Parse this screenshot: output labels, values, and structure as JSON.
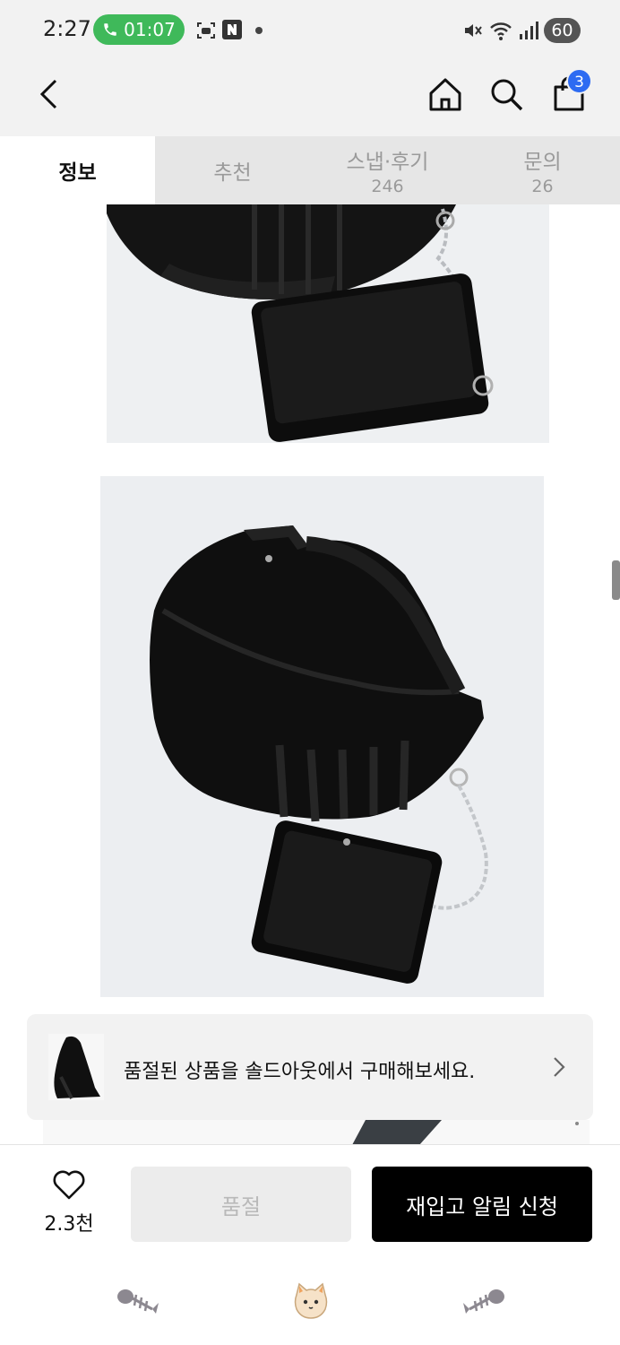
{
  "status_bar": {
    "time": "2:27",
    "call_timer": "01:07",
    "battery": "60",
    "icons": [
      "phone-icon",
      "screen-record-icon",
      "naver-icon",
      "dot-icon",
      "mute-icon",
      "wifi-icon",
      "signal-icon"
    ]
  },
  "nav": {
    "back_icon": "chevron-left-icon",
    "home_icon": "home-icon",
    "search_icon": "search-icon",
    "cart_icon": "shopping-bag-icon",
    "cart_badge": "3",
    "badge_color": "#2d6bf2"
  },
  "tabs": [
    {
      "label": "정보",
      "count": ""
    },
    {
      "label": "추천",
      "count": ""
    },
    {
      "label": "스냅·후기",
      "count": "246"
    },
    {
      "label": "문의",
      "count": "26"
    }
  ],
  "banner": {
    "text": "품절된 상품을 솔드아웃에서 구매해보세요.",
    "arrow_icon": "chevron-right-icon"
  },
  "action_bar": {
    "like_count": "2.3천",
    "soldout_label": "품절",
    "restock_label": "재입고 알림 신청"
  },
  "system_nav": {
    "icons": [
      "fishbone-icon",
      "cat-icon",
      "fishbone-icon"
    ]
  }
}
